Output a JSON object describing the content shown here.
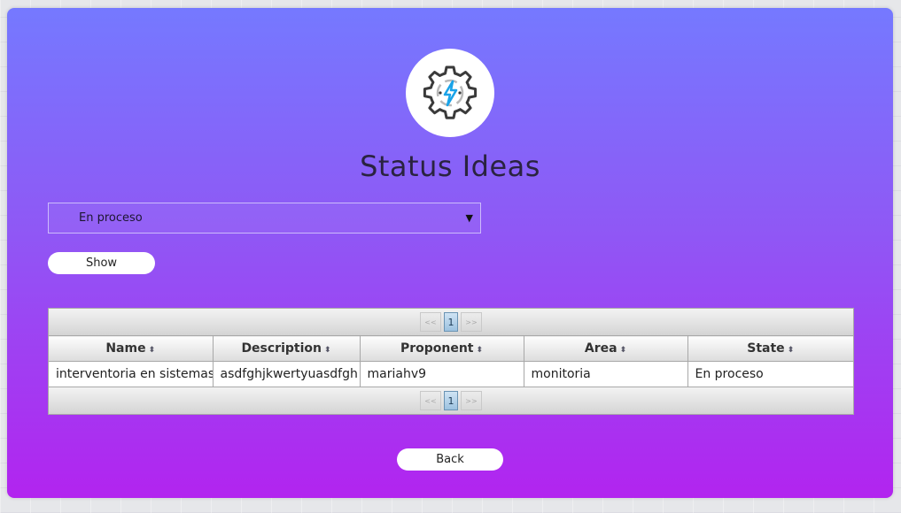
{
  "title": "Status Ideas",
  "logo_icon": "gear-lightning-icon",
  "colors": {
    "gradient_top": "#7579ff",
    "gradient_bottom": "#b224ef",
    "lightning_blue": "#1aa3e8",
    "gear_dark": "#3a3a3a"
  },
  "filter": {
    "selected": "En proceso",
    "caret": "▼"
  },
  "show_button": "Show",
  "back_button": "Back",
  "paginator": {
    "prev": "<<",
    "next": ">>",
    "page": "1"
  },
  "table": {
    "columns": [
      {
        "label": "Name",
        "sort_icon": "sort-icon"
      },
      {
        "label": "Description",
        "sort_icon": "sort-icon"
      },
      {
        "label": "Proponent",
        "sort_icon": "sort-icon"
      },
      {
        "label": "Area",
        "sort_icon": "sort-icon"
      },
      {
        "label": "State",
        "sort_icon": "sort-icon"
      }
    ],
    "rows": [
      [
        "interventoria en sistemas",
        "asdfghjkwertyuasdfgh",
        "mariahv9",
        "monitoria",
        "En proceso"
      ]
    ]
  }
}
